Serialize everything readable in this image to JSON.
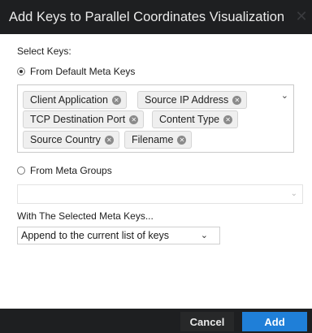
{
  "dialog": {
    "title": "Add Keys to Parallel Coordinates Visualization",
    "close_icon": "close-icon"
  },
  "form": {
    "select_keys_label": "Select Keys:",
    "option_default": "From Default Meta Keys",
    "option_groups": "From Meta Groups",
    "selected_option": "default",
    "tags": [
      "Client Application",
      "Source IP Address",
      "TCP Destination Port",
      "Content Type",
      "Source Country",
      "Filename"
    ],
    "group_select_value": "",
    "with_selected_label": "With The Selected Meta Keys...",
    "append_select_value": "Append to the current list of keys"
  },
  "footer": {
    "cancel_label": "Cancel",
    "add_label": "Add"
  },
  "colors": {
    "titlebar": "#1e1f21",
    "primary": "#1f7fd8"
  }
}
